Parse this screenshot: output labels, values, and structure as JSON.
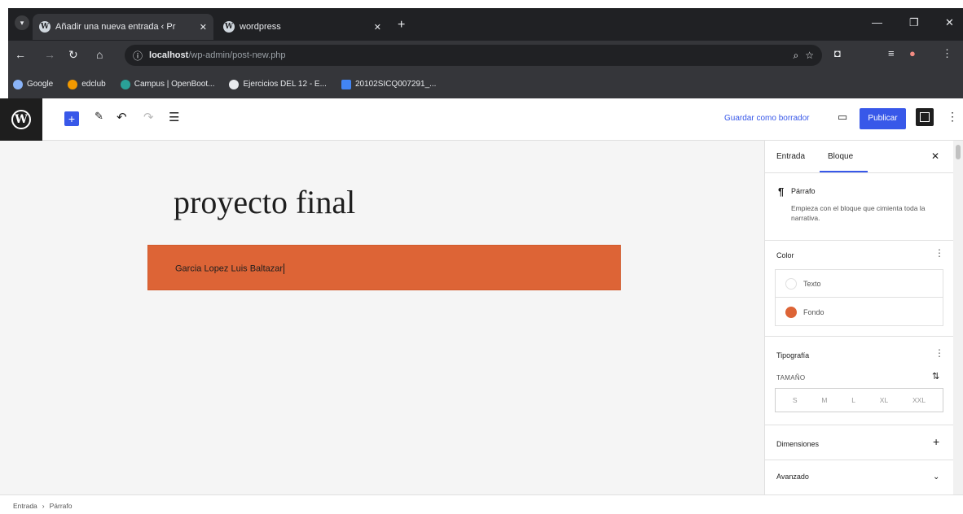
{
  "browser": {
    "tabs": [
      {
        "title": "Añadir una nueva entrada ‹ Pr",
        "active": true
      },
      {
        "title": "wordpress",
        "active": false
      }
    ],
    "new_tab": "+",
    "window_controls": {
      "minimize": "—",
      "maximize": "❐",
      "close": "✕"
    },
    "url_host": "localhost",
    "url_path": "/wp-admin/post-new.php",
    "bookmarks": [
      {
        "label": "Google",
        "color": "#8ab4f8"
      },
      {
        "label": "edclub",
        "color": "#f29900"
      },
      {
        "label": "Campus | OpenBoot...",
        "color": "#2aa198"
      },
      {
        "label": "Ejercicios DEL 12 - E...",
        "color": "#e8eaed"
      },
      {
        "label": "20102SICQ007291_...",
        "color": "#4285f4"
      }
    ]
  },
  "wp": {
    "header": {
      "save_draft": "Guardar como borrador",
      "publish": "Publicar"
    },
    "post": {
      "title": "proyecto final",
      "paragraph": "Garcia Lopez Luis Baltazar",
      "paragraph_bg": "#dd6436"
    },
    "sidebar": {
      "tabs": [
        "Entrada",
        "Bloque"
      ],
      "active_tab": "Bloque",
      "block_name": "Párrafo",
      "block_desc": "Empieza con el bloque que cimienta toda la narrativa.",
      "color_panel": {
        "title": "Color",
        "rows": [
          {
            "label": "Texto",
            "swatch": "#ffffff"
          },
          {
            "label": "Fondo",
            "swatch": "#dd6436"
          }
        ]
      },
      "typography": {
        "title": "Tipografía",
        "size_label": "TAMAÑO",
        "sizes": [
          "S",
          "M",
          "L",
          "XL",
          "XXL"
        ]
      },
      "dimensions": "Dimensiones",
      "advanced": "Avanzado"
    },
    "breadcrumb": [
      "Entrada",
      "Párrafo"
    ]
  }
}
